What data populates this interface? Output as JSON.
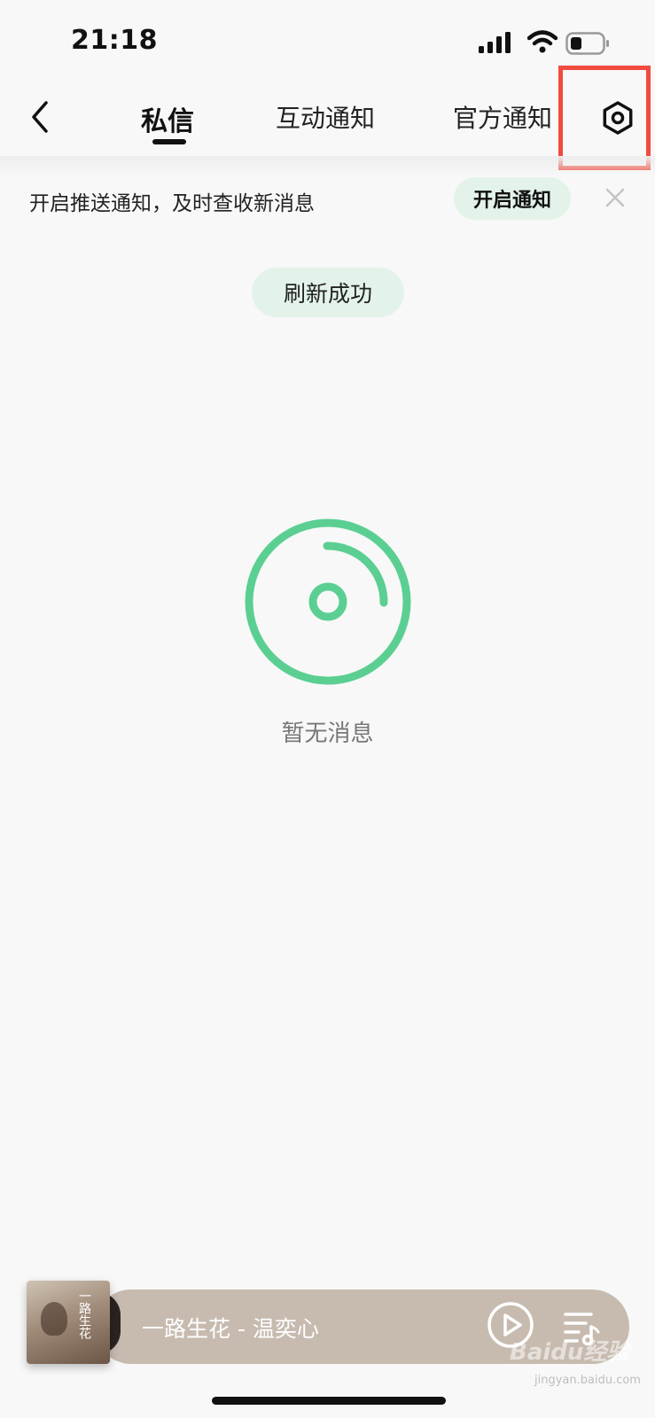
{
  "status_bar": {
    "time": "21:18"
  },
  "nav": {
    "tabs": [
      {
        "label": "私信",
        "active": true
      },
      {
        "label": "互动通知",
        "active": false
      },
      {
        "label": "官方通知",
        "active": false
      }
    ]
  },
  "push_banner": {
    "text": "开启推送通知，及时查收新消息",
    "button_label": "开启通知"
  },
  "toast": {
    "text": "刷新成功"
  },
  "empty_state": {
    "text": "暂无消息"
  },
  "mini_player": {
    "track": "一路生花 - 温奕心",
    "cover_text": "一路生花"
  },
  "watermark": {
    "text": "Baidu经验",
    "sub": "jingyan.baidu.com"
  },
  "colors": {
    "accent_green": "#5bcf92",
    "pill_green_bg": "#e3f3ea",
    "highlight_red": "#f04b3e",
    "player_bg": "#c7bbb0"
  }
}
